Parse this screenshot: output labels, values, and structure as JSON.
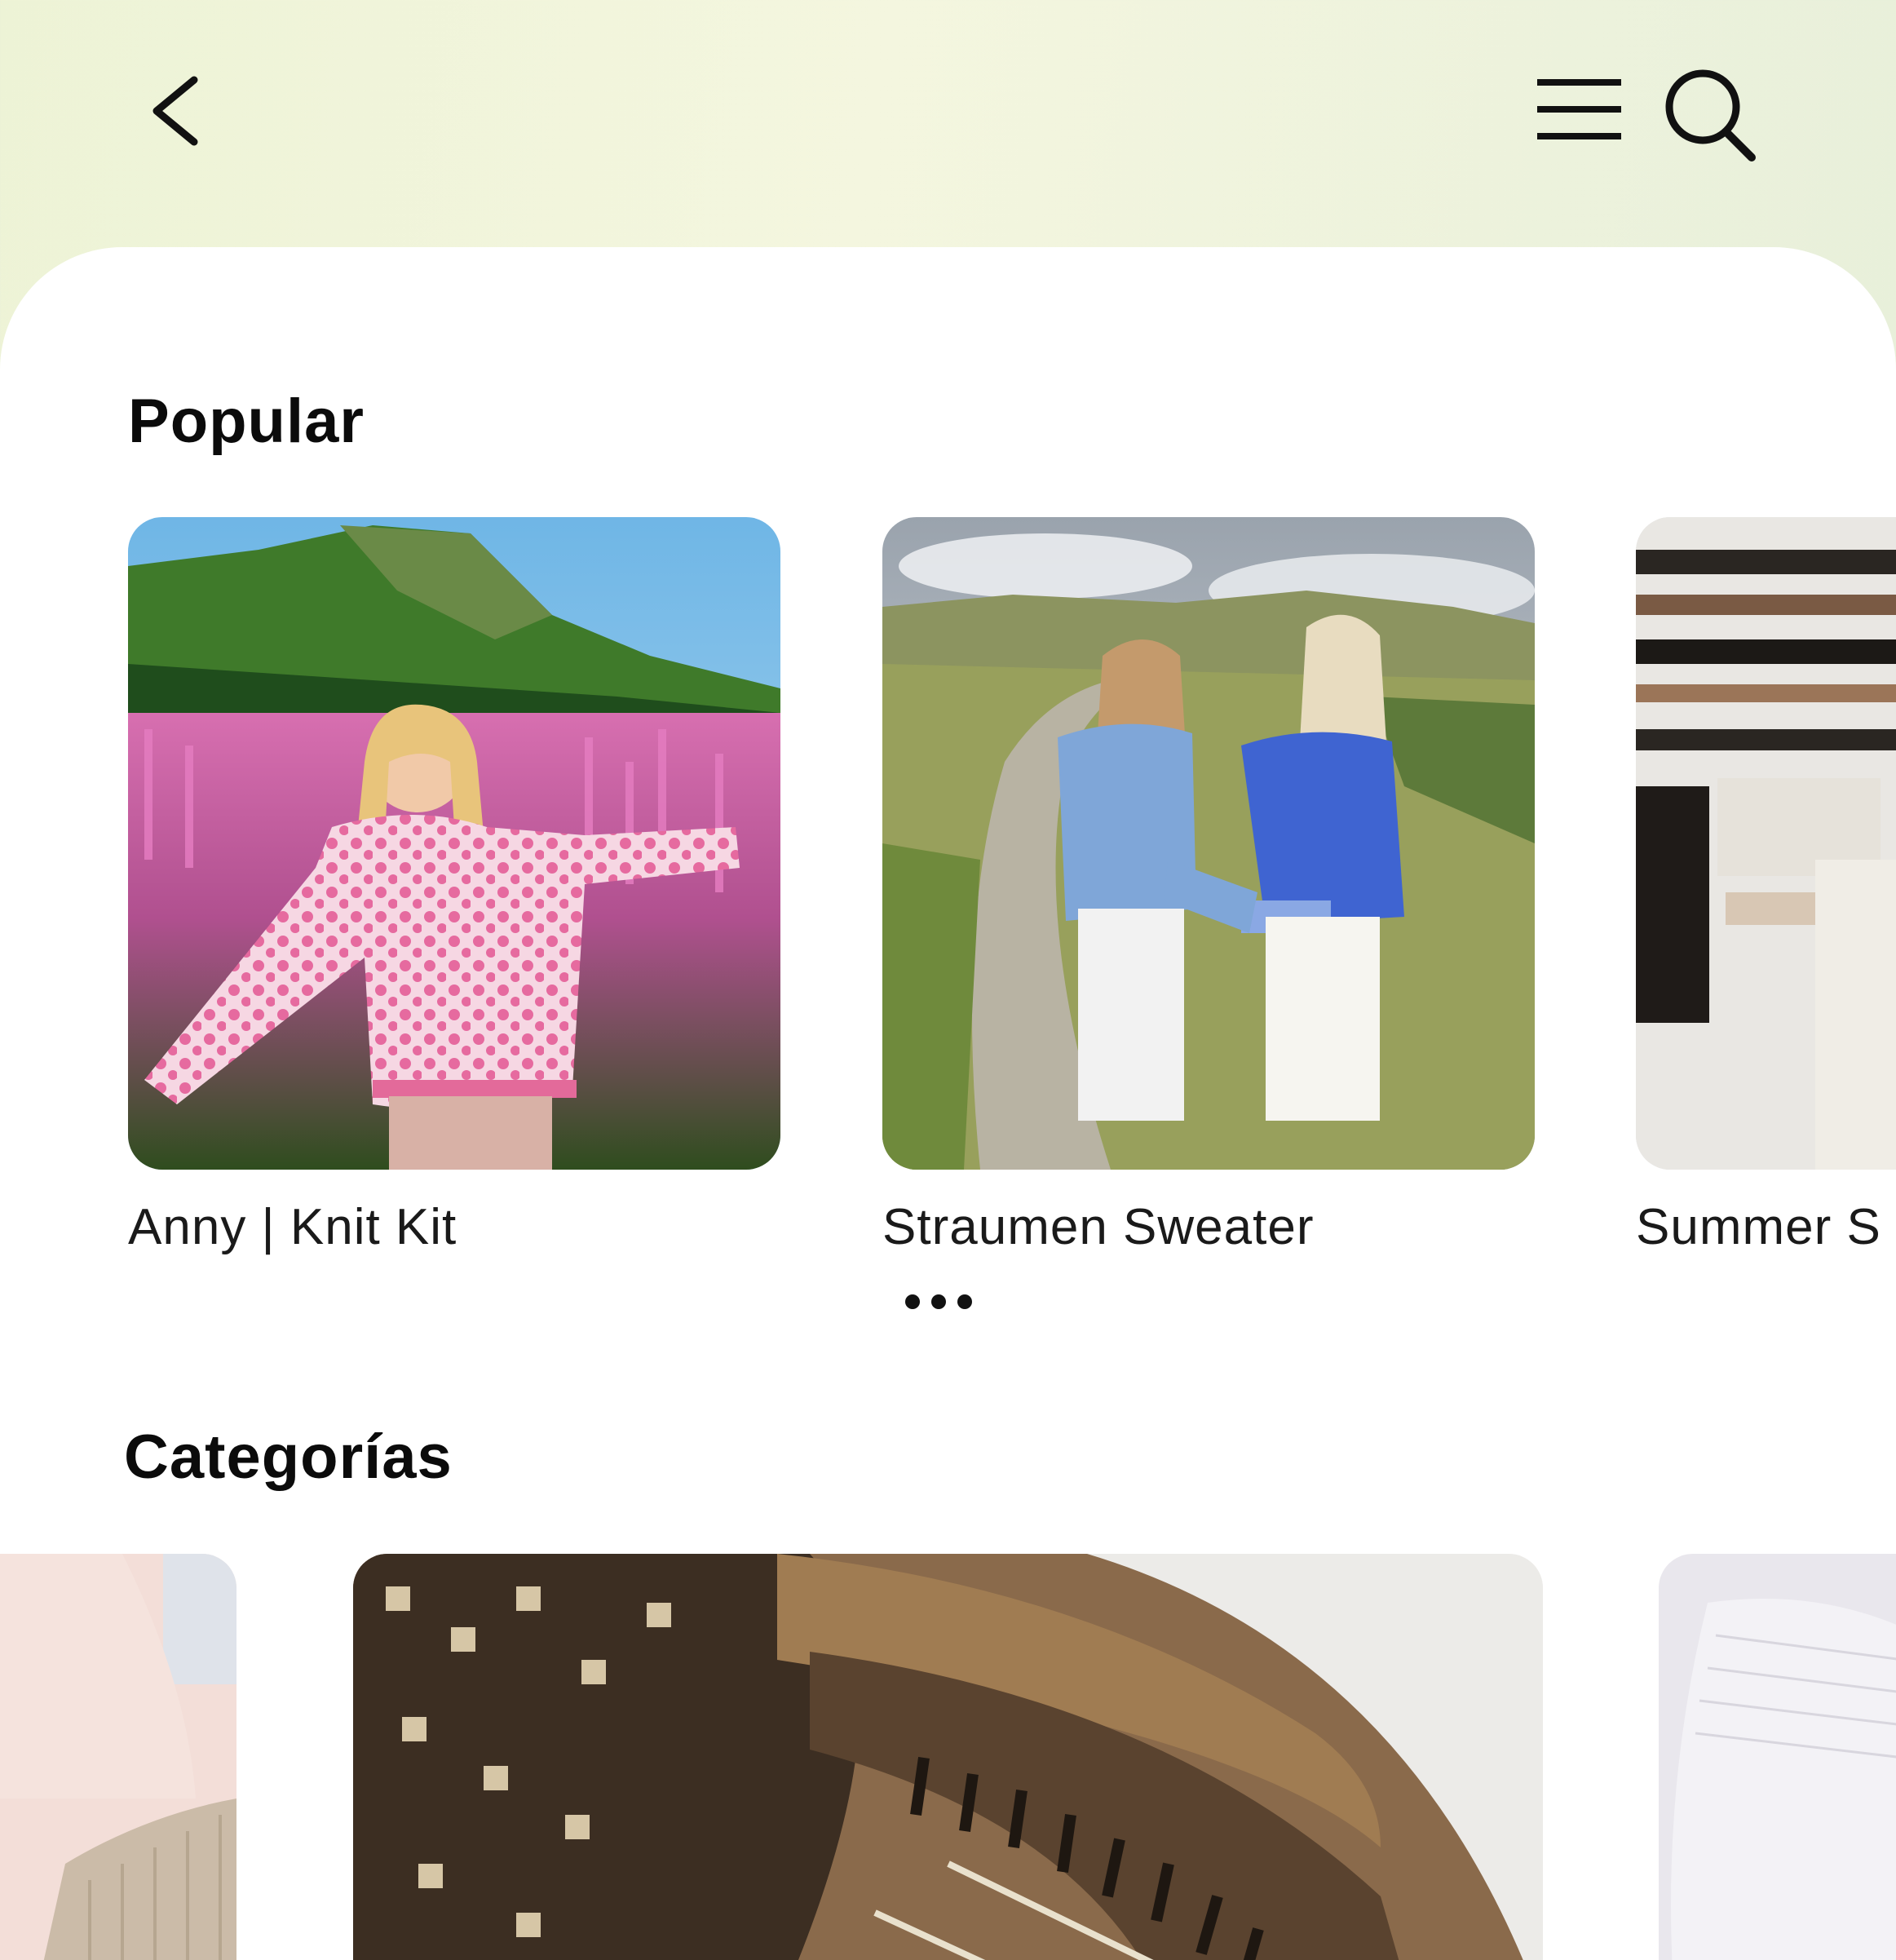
{
  "header": {
    "back_icon": "chevron-left-icon",
    "menu_icon": "hamburger-menu-icon",
    "search_icon": "search-icon"
  },
  "popular": {
    "title": "Popular",
    "items": [
      {
        "label": "Anny | Knit Kit"
      },
      {
        "label": "Straumen Sweater"
      },
      {
        "label": "Summer S"
      }
    ],
    "pager_dots": 3
  },
  "categories": {
    "title": "Categorías"
  },
  "colors": {
    "background_gradient_start": "#edf3d6",
    "background_gradient_end": "#e5eed9",
    "sheet": "#ffffff",
    "text": "#111111"
  }
}
